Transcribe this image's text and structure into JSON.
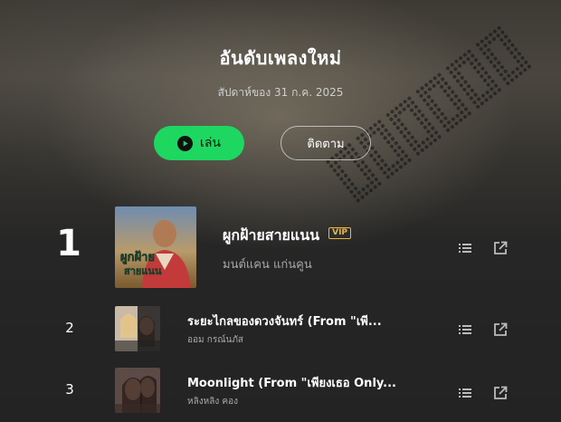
{
  "header": {
    "title": "อันดับเพลงใหม่",
    "subtitle": "สัปดาห์ของ 31 ก.ค. 2025"
  },
  "actions": {
    "play_label": "เล่น",
    "follow_label": "ติดตาม"
  },
  "colors": {
    "accent": "#1ed760",
    "vip": "#e8b840"
  },
  "tracks": [
    {
      "rank": "1",
      "title": "ผูกฝ้ายสายแนน",
      "artist": "มนต์แคน แก่นคูน",
      "badge": "VIP"
    },
    {
      "rank": "2",
      "title": "ระยะไกลของดวงจันทร์ (From \"เพี...",
      "artist": "ออม กรณ์นภัส"
    },
    {
      "rank": "3",
      "title": "Moonlight (From \"เพียงเธอ Only...",
      "artist": "หลิงหลิง คอง"
    }
  ],
  "icons": {
    "list": "list-icon",
    "share": "share-icon",
    "play": "play-circle-icon"
  }
}
